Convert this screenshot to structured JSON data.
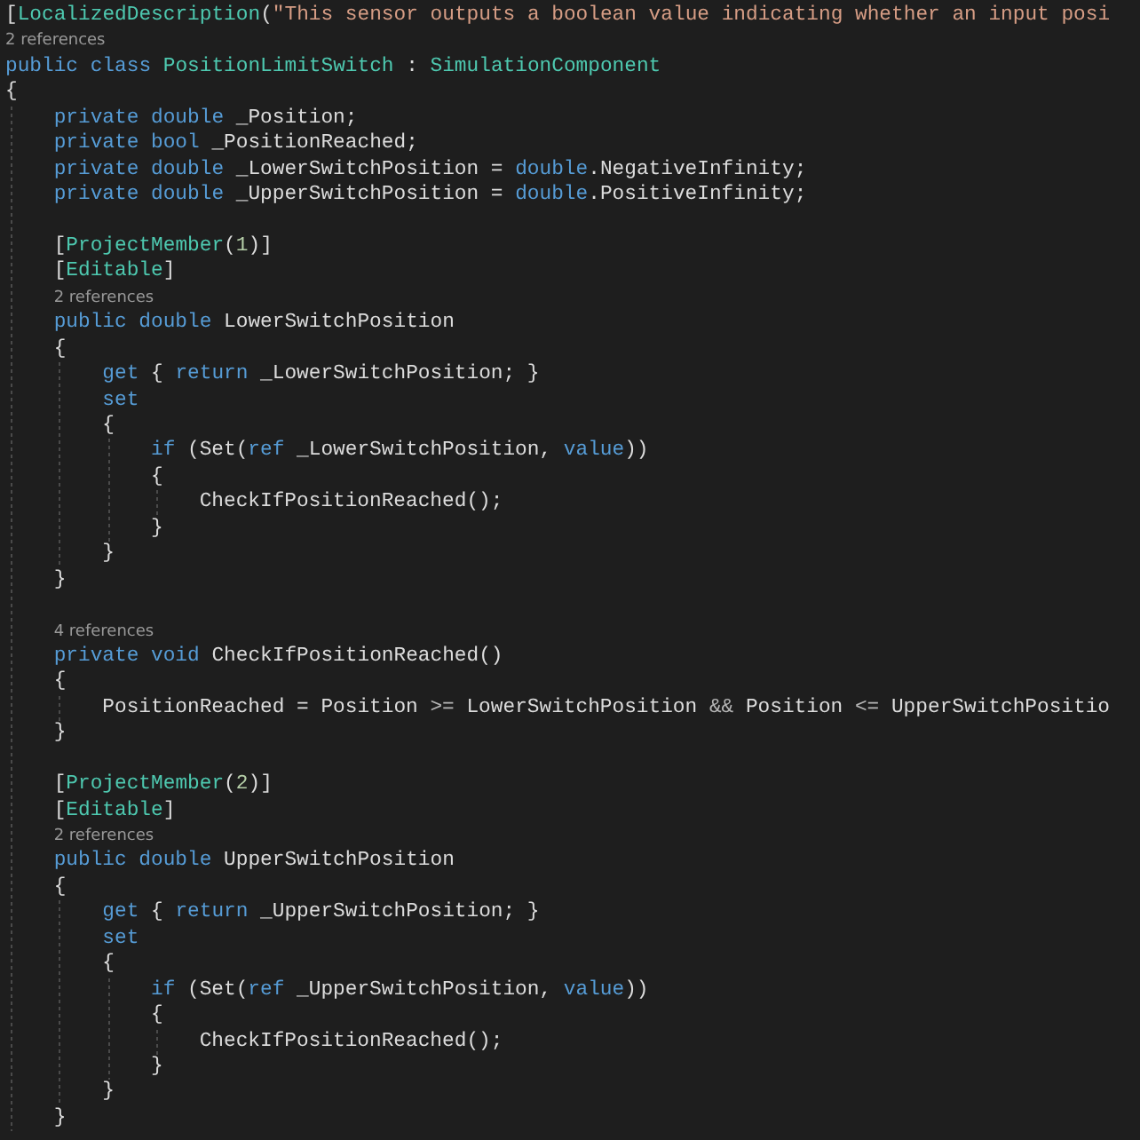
{
  "editor": {
    "lines": [
      {
        "kind": "code",
        "tokens": [
          {
            "kind": "plain",
            "text": "["
          },
          {
            "kind": "type",
            "text": "LocalizedDescription"
          },
          {
            "kind": "plain",
            "text": "("
          },
          {
            "kind": "str",
            "text": "\"This sensor outputs a boolean value indicating whether an input posi"
          }
        ]
      },
      {
        "kind": "lens",
        "text": "2 references"
      },
      {
        "kind": "code",
        "tokens": [
          {
            "kind": "kw",
            "text": "public class "
          },
          {
            "kind": "type",
            "text": "PositionLimitSwitch"
          },
          {
            "kind": "plain",
            "text": " : "
          },
          {
            "kind": "type",
            "text": "SimulationComponent"
          }
        ]
      },
      {
        "kind": "code",
        "tokens": [
          {
            "kind": "plain",
            "text": "{"
          }
        ]
      },
      {
        "kind": "block",
        "children": [
          {
            "kind": "code",
            "tokens": [
              {
                "kind": "kw",
                "text": "private double "
              },
              {
                "kind": "plain",
                "text": "_Position;"
              }
            ]
          },
          {
            "kind": "code",
            "tokens": [
              {
                "kind": "kw",
                "text": "private bool "
              },
              {
                "kind": "plain",
                "text": "_PositionReached;"
              }
            ]
          },
          {
            "kind": "code",
            "tokens": [
              {
                "kind": "kw",
                "text": "private double "
              },
              {
                "kind": "plain",
                "text": "_LowerSwitchPosition = "
              },
              {
                "kind": "kw",
                "text": "double"
              },
              {
                "kind": "plain",
                "text": ".NegativeInfinity;"
              }
            ]
          },
          {
            "kind": "code",
            "tokens": [
              {
                "kind": "kw",
                "text": "private double "
              },
              {
                "kind": "plain",
                "text": "_UpperSwitchPosition = "
              },
              {
                "kind": "kw",
                "text": "double"
              },
              {
                "kind": "plain",
                "text": ".PositiveInfinity;"
              }
            ]
          },
          {
            "kind": "blank"
          },
          {
            "kind": "code",
            "tokens": [
              {
                "kind": "plain",
                "text": "["
              },
              {
                "kind": "type",
                "text": "ProjectMember"
              },
              {
                "kind": "plain",
                "text": "("
              },
              {
                "kind": "num",
                "text": "1"
              },
              {
                "kind": "plain",
                "text": ")]"
              }
            ]
          },
          {
            "kind": "code",
            "tokens": [
              {
                "kind": "plain",
                "text": "["
              },
              {
                "kind": "type",
                "text": "Editable"
              },
              {
                "kind": "plain",
                "text": "]"
              }
            ]
          },
          {
            "kind": "lens",
            "text": "2 references"
          },
          {
            "kind": "code",
            "tokens": [
              {
                "kind": "kw",
                "text": "public double "
              },
              {
                "kind": "plain",
                "text": "LowerSwitchPosition"
              }
            ]
          },
          {
            "kind": "code",
            "tokens": [
              {
                "kind": "plain",
                "text": "{"
              }
            ]
          },
          {
            "kind": "block",
            "children": [
              {
                "kind": "code",
                "tokens": [
                  {
                    "kind": "kw",
                    "text": "get"
                  },
                  {
                    "kind": "plain",
                    "text": " { "
                  },
                  {
                    "kind": "kw",
                    "text": "return"
                  },
                  {
                    "kind": "plain",
                    "text": " _LowerSwitchPosition; }"
                  }
                ]
              },
              {
                "kind": "code",
                "tokens": [
                  {
                    "kind": "kw",
                    "text": "set"
                  }
                ]
              },
              {
                "kind": "code",
                "tokens": [
                  {
                    "kind": "plain",
                    "text": "{"
                  }
                ]
              },
              {
                "kind": "block",
                "children": [
                  {
                    "kind": "code",
                    "tokens": [
                      {
                        "kind": "kw",
                        "text": "if"
                      },
                      {
                        "kind": "plain",
                        "text": " (Set("
                      },
                      {
                        "kind": "kw",
                        "text": "ref"
                      },
                      {
                        "kind": "plain",
                        "text": " _LowerSwitchPosition, "
                      },
                      {
                        "kind": "kw",
                        "text": "value"
                      },
                      {
                        "kind": "plain",
                        "text": "))"
                      }
                    ]
                  },
                  {
                    "kind": "code",
                    "tokens": [
                      {
                        "kind": "plain",
                        "text": "{"
                      }
                    ]
                  },
                  {
                    "kind": "block",
                    "children": [
                      {
                        "kind": "code",
                        "tokens": [
                          {
                            "kind": "plain",
                            "text": "CheckIfPositionReached();"
                          }
                        ]
                      }
                    ]
                  },
                  {
                    "kind": "code",
                    "tokens": [
                      {
                        "kind": "plain",
                        "text": "}"
                      }
                    ]
                  }
                ]
              },
              {
                "kind": "code",
                "tokens": [
                  {
                    "kind": "plain",
                    "text": "}"
                  }
                ]
              }
            ]
          },
          {
            "kind": "code",
            "tokens": [
              {
                "kind": "plain",
                "text": "}"
              }
            ]
          },
          {
            "kind": "blank"
          },
          {
            "kind": "lens",
            "text": "4 references"
          },
          {
            "kind": "code",
            "tokens": [
              {
                "kind": "kw",
                "text": "private void "
              },
              {
                "kind": "plain",
                "text": "CheckIfPositionReached()"
              }
            ]
          },
          {
            "kind": "code",
            "tokens": [
              {
                "kind": "plain",
                "text": "{"
              }
            ]
          },
          {
            "kind": "block",
            "children": [
              {
                "kind": "code",
                "tokens": [
                  {
                    "kind": "plain",
                    "text": "PositionReached = Position "
                  },
                  {
                    "kind": "op",
                    "text": ">="
                  },
                  {
                    "kind": "plain",
                    "text": " LowerSwitchPosition "
                  },
                  {
                    "kind": "op",
                    "text": "&&"
                  },
                  {
                    "kind": "plain",
                    "text": " Position "
                  },
                  {
                    "kind": "op",
                    "text": "<="
                  },
                  {
                    "kind": "plain",
                    "text": " UpperSwitchPositio"
                  }
                ]
              }
            ]
          },
          {
            "kind": "code",
            "tokens": [
              {
                "kind": "plain",
                "text": "}"
              }
            ]
          },
          {
            "kind": "blank"
          },
          {
            "kind": "code",
            "tokens": [
              {
                "kind": "plain",
                "text": "["
              },
              {
                "kind": "type",
                "text": "ProjectMember"
              },
              {
                "kind": "plain",
                "text": "("
              },
              {
                "kind": "num",
                "text": "2"
              },
              {
                "kind": "plain",
                "text": ")]"
              }
            ]
          },
          {
            "kind": "code",
            "tokens": [
              {
                "kind": "plain",
                "text": "["
              },
              {
                "kind": "type",
                "text": "Editable"
              },
              {
                "kind": "plain",
                "text": "]"
              }
            ]
          },
          {
            "kind": "lens",
            "text": "2 references"
          },
          {
            "kind": "code",
            "tokens": [
              {
                "kind": "kw",
                "text": "public double "
              },
              {
                "kind": "plain",
                "text": "UpperSwitchPosition"
              }
            ]
          },
          {
            "kind": "code",
            "tokens": [
              {
                "kind": "plain",
                "text": "{"
              }
            ]
          },
          {
            "kind": "block",
            "children": [
              {
                "kind": "code",
                "tokens": [
                  {
                    "kind": "kw",
                    "text": "get"
                  },
                  {
                    "kind": "plain",
                    "text": " { "
                  },
                  {
                    "kind": "kw",
                    "text": "return"
                  },
                  {
                    "kind": "plain",
                    "text": " _UpperSwitchPosition; }"
                  }
                ]
              },
              {
                "kind": "code",
                "tokens": [
                  {
                    "kind": "kw",
                    "text": "set"
                  }
                ]
              },
              {
                "kind": "code",
                "tokens": [
                  {
                    "kind": "plain",
                    "text": "{"
                  }
                ]
              },
              {
                "kind": "block",
                "children": [
                  {
                    "kind": "code",
                    "tokens": [
                      {
                        "kind": "kw",
                        "text": "if"
                      },
                      {
                        "kind": "plain",
                        "text": " (Set("
                      },
                      {
                        "kind": "kw",
                        "text": "ref"
                      },
                      {
                        "kind": "plain",
                        "text": " _UpperSwitchPosition, "
                      },
                      {
                        "kind": "kw",
                        "text": "value"
                      },
                      {
                        "kind": "plain",
                        "text": "))"
                      }
                    ]
                  },
                  {
                    "kind": "code",
                    "tokens": [
                      {
                        "kind": "plain",
                        "text": "{"
                      }
                    ]
                  },
                  {
                    "kind": "block",
                    "children": [
                      {
                        "kind": "code",
                        "tokens": [
                          {
                            "kind": "plain",
                            "text": "CheckIfPositionReached();"
                          }
                        ]
                      }
                    ]
                  },
                  {
                    "kind": "code",
                    "tokens": [
                      {
                        "kind": "plain",
                        "text": "}"
                      }
                    ]
                  }
                ]
              },
              {
                "kind": "code",
                "tokens": [
                  {
                    "kind": "plain",
                    "text": "}"
                  }
                ]
              }
            ]
          },
          {
            "kind": "code",
            "tokens": [
              {
                "kind": "plain",
                "text": "}"
              }
            ]
          }
        ]
      }
    ]
  }
}
